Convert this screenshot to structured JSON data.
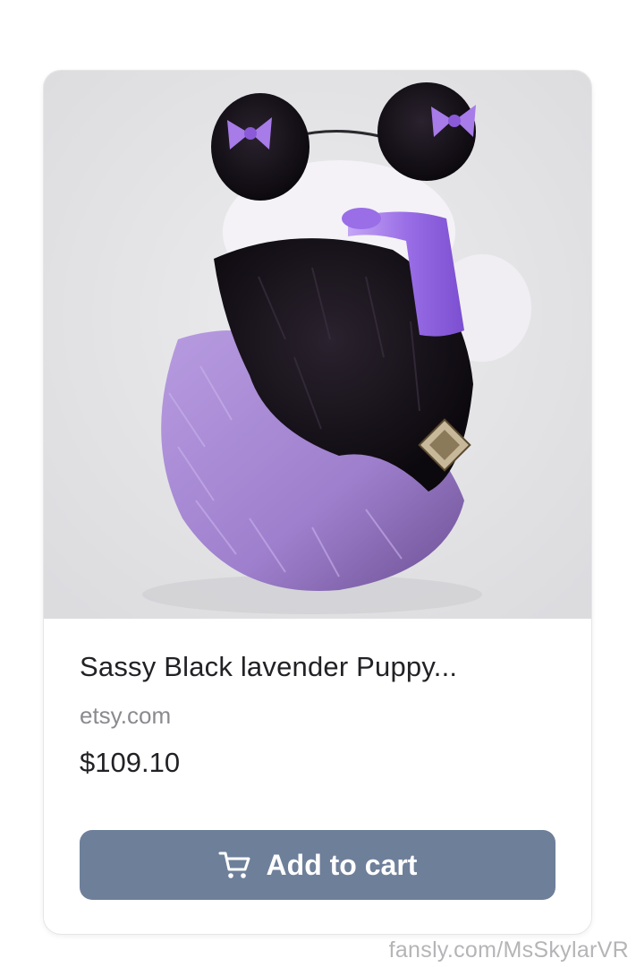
{
  "product": {
    "title": "Sassy Black lavender Puppy...",
    "source": "etsy.com",
    "price": "$109.10",
    "image_icon": "product-photo"
  },
  "actions": {
    "add_to_cart_label": "Add to cart",
    "cart_icon": "cart-icon"
  },
  "watermark": "fansly.com/MsSkylarVR",
  "colors": {
    "button": "#6e7f9a",
    "card_border": "#e6e6e6",
    "image_background": "#e6e6e8",
    "fur_black": "#141016",
    "fur_lavender": "#a98bd6",
    "ribbon": "#9b6fe0"
  }
}
